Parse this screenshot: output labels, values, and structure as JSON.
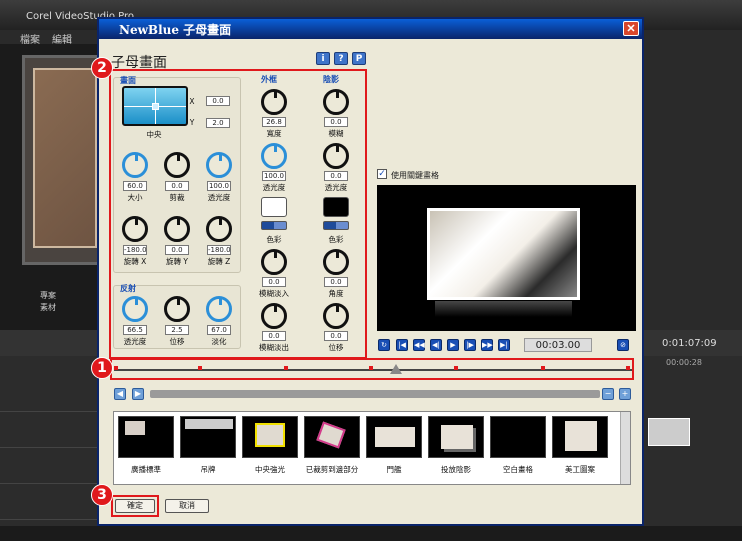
{
  "background": {
    "app_title": "Corel VideoStudio Pro",
    "menu": [
      "檔案",
      "編輯"
    ],
    "tabs": [
      "專案",
      "素材"
    ],
    "timecodes": [
      "0:01:07:09",
      "00:00:28"
    ]
  },
  "dialog": {
    "title": "NewBlue 子母畫面",
    "heading": "子母畫面",
    "top_buttons": [
      "i",
      "?",
      "P"
    ],
    "groups": {
      "picture": "畫面",
      "outline": "外框",
      "shadow": "陰影",
      "reflection": "反射"
    },
    "position": {
      "x_label": "X",
      "x_value": "0.0",
      "y_label": "Y",
      "y_value": "2.0",
      "center_label": "中央"
    },
    "picture_knobs": [
      {
        "value": "60.0",
        "label": "大小"
      },
      {
        "value": "0.0",
        "label": "剪裁"
      },
      {
        "value": "100.0",
        "label": "透光度"
      },
      {
        "value": "-180.0",
        "label": "旋轉 X"
      },
      {
        "value": "0.0",
        "label": "旋轉 Y"
      },
      {
        "value": "-180.0",
        "label": "旋轉 Z"
      }
    ],
    "reflection_knobs": [
      {
        "value": "66.5",
        "label": "透光度"
      },
      {
        "value": "2.5",
        "label": "位移"
      },
      {
        "value": "67.0",
        "label": "淡化"
      }
    ],
    "outline": {
      "width_value": "26.8",
      "width_label": "寬度",
      "opacity_value": "100.0",
      "opacity_label": "透光度",
      "color_label": "色彩",
      "fadein_value": "0.0",
      "fadein_label": "模糊淡入",
      "fadeout_value": "0.0",
      "fadeout_label": "模糊淡出"
    },
    "shadow": {
      "blur_value": "0.0",
      "blur_label": "模糊",
      "opacity_value": "0.0",
      "opacity_label": "透光度",
      "color_label": "色彩",
      "angle_value": "0.0",
      "angle_label": "角度",
      "offset_value": "0.0",
      "offset_label": "位移"
    },
    "use_keyframes_label": "使用關鍵畫格",
    "timecode": "00:03.00",
    "presets": [
      "廣播標準",
      "吊牌",
      "中央強光",
      "已裁剪到邊部分",
      "門艦",
      "投放陰影",
      "空白畫格",
      "美工圖案"
    ],
    "ok_label": "確定",
    "cancel_label": "取消",
    "badges": [
      "1",
      "2",
      "3"
    ]
  }
}
